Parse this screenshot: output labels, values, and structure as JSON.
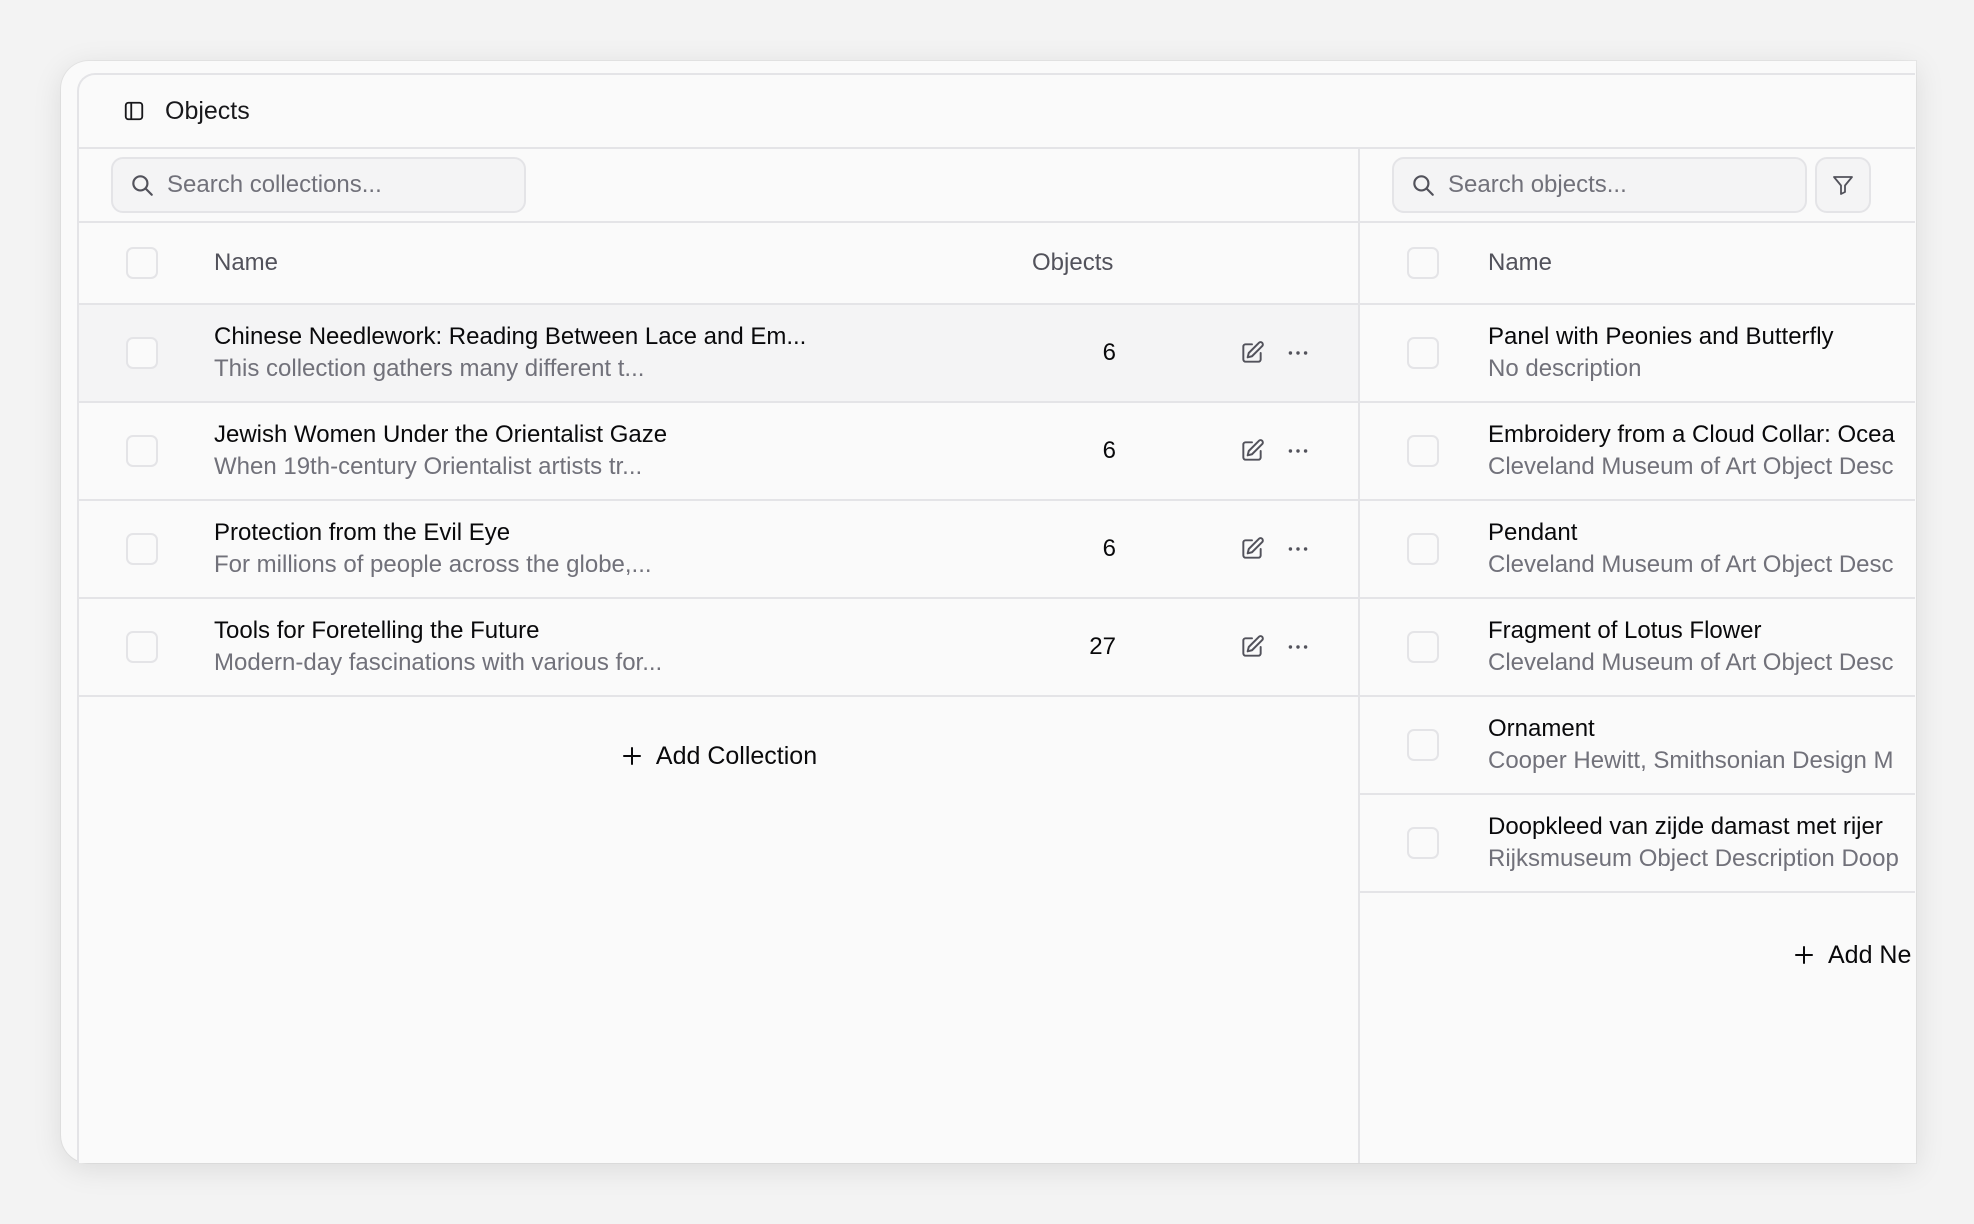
{
  "window": {
    "title": "Objects"
  },
  "collections": {
    "search_placeholder": "Search collections...",
    "header": {
      "name": "Name",
      "objects": "Objects"
    },
    "rows": [
      {
        "title": "Chinese Needlework: Reading Between Lace and Em...",
        "desc": "This collection gathers many different t...",
        "count": "6"
      },
      {
        "title": "Jewish Women Under the Orientalist Gaze",
        "desc": "When 19th-century Orientalist artists tr...",
        "count": "6"
      },
      {
        "title": "Protection from the Evil Eye",
        "desc": "For millions of people across the globe,...",
        "count": "6"
      },
      {
        "title": "Tools for Foretelling the Future",
        "desc": "Modern-day fascinations with various for...",
        "count": "27"
      }
    ],
    "add_label": "Add Collection"
  },
  "objects": {
    "search_placeholder": "Search objects...",
    "header": {
      "name": "Name"
    },
    "rows": [
      {
        "title": "Panel with Peonies and Butterfly",
        "desc": "No description"
      },
      {
        "title": "Embroidery from a Cloud Collar: Ocea",
        "desc": "Cleveland Museum of Art Object Desc"
      },
      {
        "title": "Pendant",
        "desc": "Cleveland Museum of Art Object Desc"
      },
      {
        "title": "Fragment of Lotus Flower",
        "desc": "Cleveland Museum of Art Object Desc"
      },
      {
        "title": "Ornament",
        "desc": "Cooper Hewitt, Smithsonian Design M"
      },
      {
        "title": "Doopkleed van zijde damast met rijer",
        "desc": "Rijksmuseum Object Description Doop"
      }
    ],
    "add_label": "Add Ne"
  }
}
